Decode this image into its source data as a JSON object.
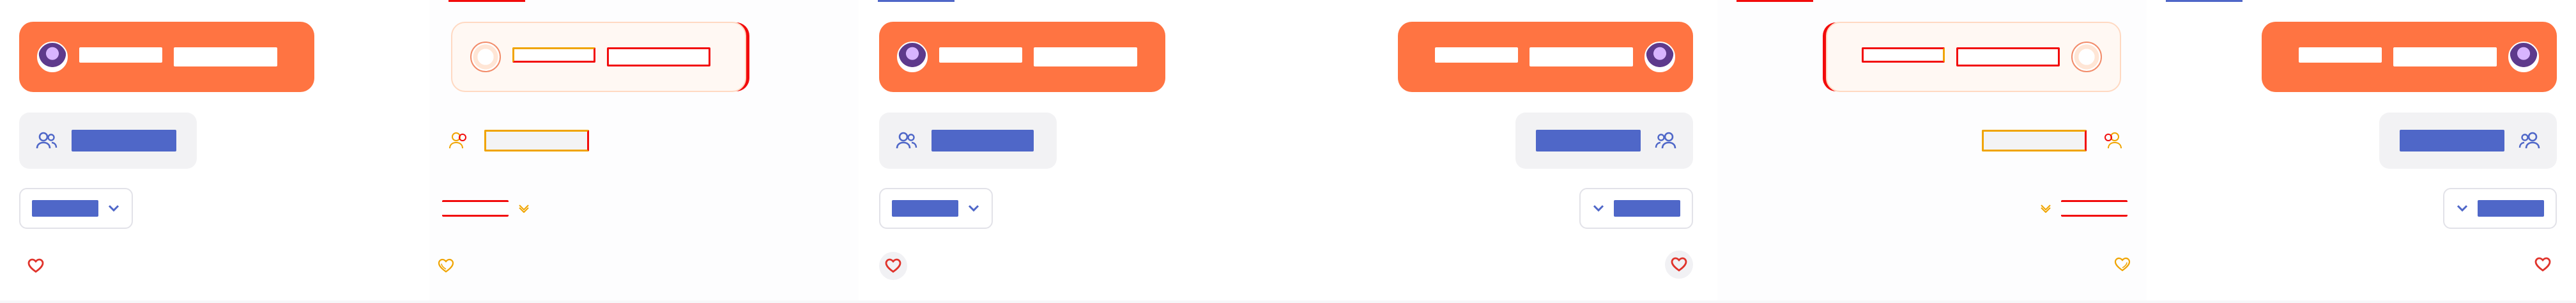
{
  "colors": {
    "accent": "#ff7442",
    "label_fill": "#4f67c8",
    "heart": "#e0332b",
    "outline_red": "#f20b0b",
    "outline_gold": "#f0a400"
  },
  "panels": [
    {
      "dir": "ltr",
      "variant": "filled",
      "name": "",
      "subtitle": "",
      "audience": "",
      "dropdown": "",
      "icons": [
        "avatar",
        "people-icon",
        "chevron-down-icon",
        "heart-icon"
      ]
    },
    {
      "dir": "ltr",
      "variant": "outline",
      "name": "",
      "subtitle": "",
      "audience": "",
      "dropdown": "",
      "icons": [
        "avatar",
        "people-icon",
        "chevron-down-icon",
        "heart-icon"
      ]
    },
    {
      "dir": "ltr",
      "variant": "filled",
      "name": "",
      "subtitle": "",
      "audience": "",
      "dropdown": "",
      "icons": [
        "avatar",
        "people-icon",
        "chevron-down-icon",
        "heart-icon"
      ]
    },
    {
      "dir": "rtl",
      "variant": "filled",
      "name": "",
      "subtitle": "",
      "audience": "",
      "dropdown": "",
      "icons": [
        "avatar",
        "people-icon",
        "chevron-down-icon",
        "heart-icon"
      ]
    },
    {
      "dir": "rtl",
      "variant": "outline",
      "name": "",
      "subtitle": "",
      "audience": "",
      "dropdown": "",
      "icons": [
        "avatar",
        "people-icon",
        "chevron-down-icon",
        "heart-icon"
      ]
    },
    {
      "dir": "rtl",
      "variant": "filled",
      "name": "",
      "subtitle": "",
      "audience": "",
      "dropdown": "",
      "icons": [
        "avatar",
        "people-icon",
        "chevron-down-icon",
        "heart-icon"
      ]
    }
  ]
}
